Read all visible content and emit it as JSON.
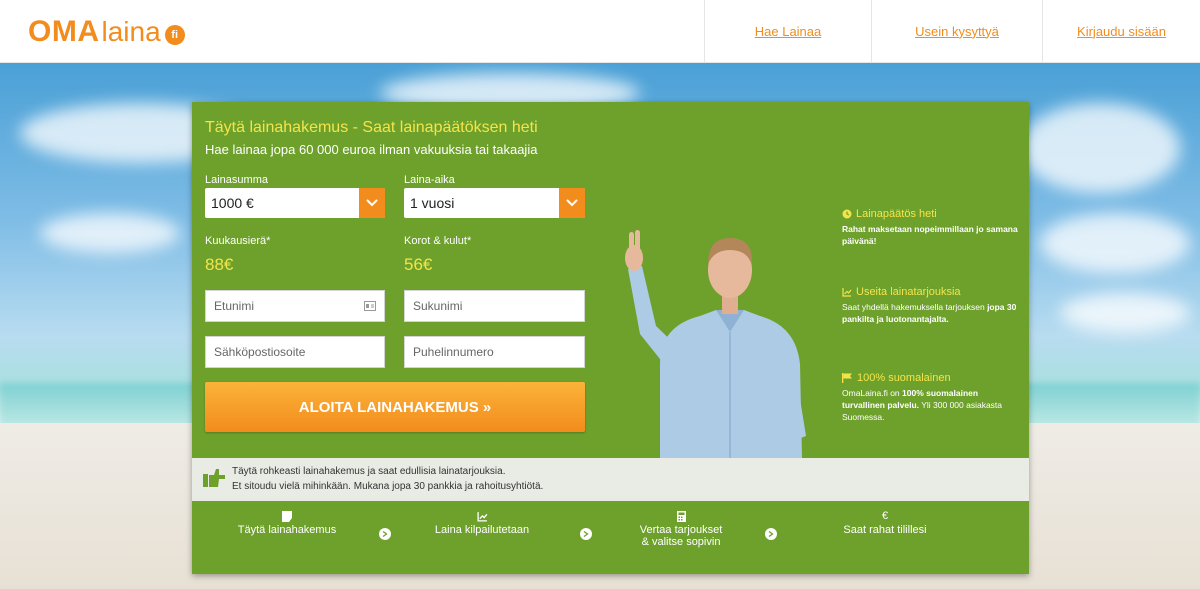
{
  "header": {
    "logo": {
      "oma": "OMA",
      "laina": "laina",
      "badge": "fi"
    },
    "nav": [
      "Hae Lainaa",
      "Usein kysyttyä",
      "Kirjaudu sisään"
    ]
  },
  "form": {
    "title": "Täytä lainahakemus - Saat lainapäätöksen heti",
    "subtitle": "Hae lainaa jopa 60 000 euroa ilman vakuuksia tai takaajia",
    "amount_label": "Lainasumma",
    "amount_value": "1000 €",
    "period_label": "Laina-aika",
    "period_value": "1 vuosi",
    "monthly_label": "Kuukausierä*",
    "monthly_value": "88€",
    "costs_label": "Korot & kulut*",
    "costs_value": "56€",
    "firstname_placeholder": "Etunimi",
    "lastname_placeholder": "Sukunimi",
    "email_placeholder": "Sähköpostiosoite",
    "phone_placeholder": "Puhelinnumero",
    "cta_label": "ALOITA LAINAHAKEMUS »"
  },
  "features": [
    {
      "icon": "clock-icon",
      "title": "Lainapäätös heti",
      "desc_bold": "Rahat maksetaan nopeimmillaan jo samana päivänä!",
      "desc": ""
    },
    {
      "icon": "chart-icon",
      "title": "Useita lainatarjouksia",
      "desc_pre": "Saat yhdellä hakemuksella tarjouksen ",
      "desc_bold": "jopa 30 pankilta ja luotonantajalta.",
      "desc": ""
    },
    {
      "icon": "flag-icon",
      "title": "100% suomalainen",
      "desc_pre": "OmaLaina.fi on ",
      "desc_bold": "100% suomalainen turvallinen palvelu.",
      "desc": "Yli 300 000 asiakasta Suomessa."
    }
  ],
  "info": {
    "line1": "Täytä rohkeasti lainahakemus ja saat edullisia lainatarjouksia.",
    "line2": "Et sitoudu vielä mihinkään. Mukana jopa 30 pankkia ja rahoitusyhtiötä."
  },
  "steps": [
    {
      "icon": "document-icon",
      "label": "Täytä lainahakemus",
      "label2": ""
    },
    {
      "icon": "chart-icon",
      "label": "Laina kilpailutetaan",
      "label2": ""
    },
    {
      "icon": "calculator-icon",
      "label": "Vertaa tarjoukset",
      "label2": "& valitse sopivin"
    },
    {
      "icon": "euro-icon",
      "label": "Saat rahat tilillesi",
      "label2": "",
      "glyph": "€"
    }
  ],
  "colors": {
    "accent": "#f28c1c",
    "card": "#6ea12b",
    "highlight": "#f4e44b"
  }
}
